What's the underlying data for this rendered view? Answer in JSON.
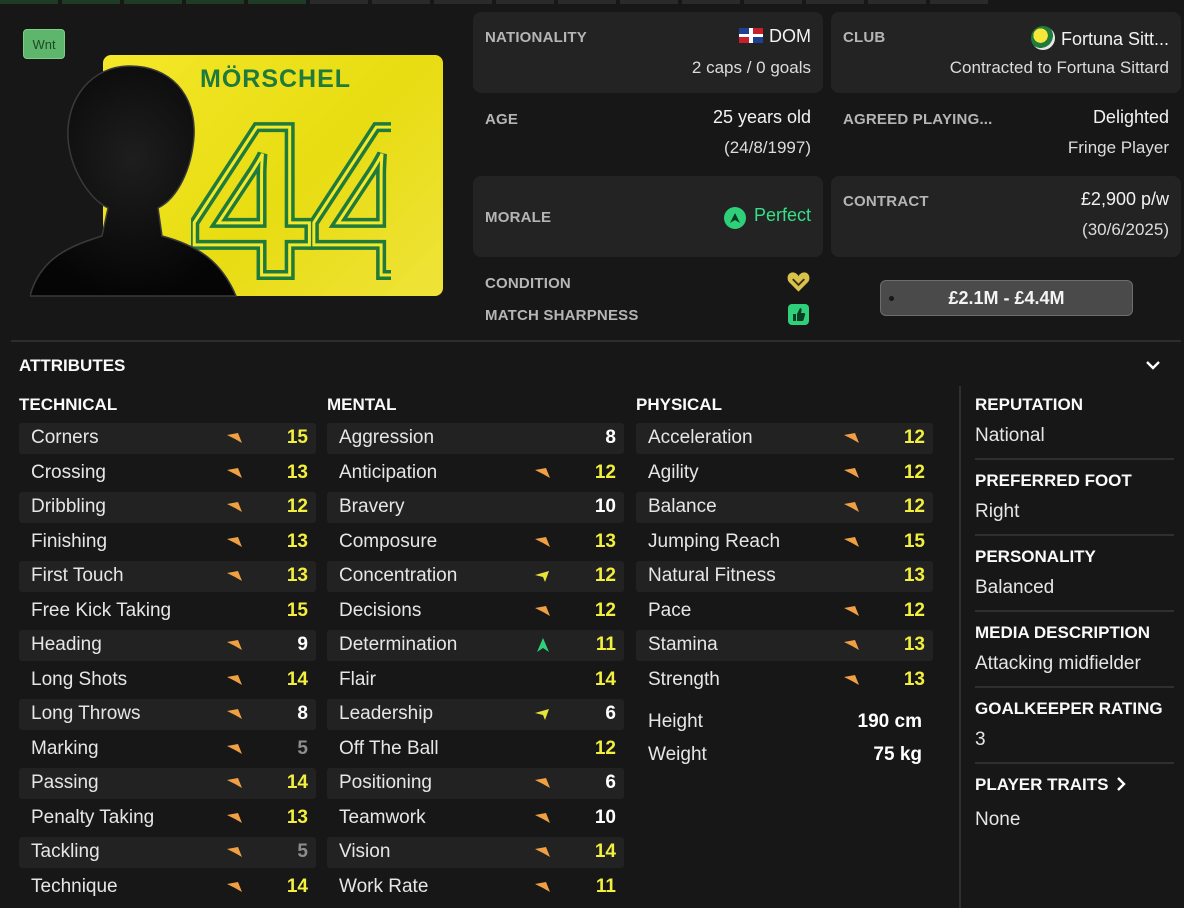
{
  "badge": "Wnt",
  "shirt": {
    "name": "MÖRSCHEL",
    "number": "44"
  },
  "header": {
    "nationality": {
      "label": "NATIONALITY",
      "value": "DOM",
      "sub": "2 caps / 0 goals",
      "flag_icon": "dominican-republic-flag"
    },
    "club": {
      "label": "CLUB",
      "value": "Fortuna Sitt...",
      "sub": "Contracted to Fortuna Sittard",
      "crest_icon": "fortuna-sittard-crest"
    },
    "age": {
      "label": "AGE",
      "value": "25 years old",
      "sub": "(24/8/1997)"
    },
    "playing_time": {
      "label": "AGREED PLAYING...",
      "value": "Delighted",
      "sub": "Fringe Player"
    },
    "morale": {
      "label": "MORALE",
      "value": "Perfect",
      "icon": "morale-up-icon",
      "color": "#35e088"
    },
    "contract": {
      "label": "CONTRACT",
      "value": "£2,900 p/w",
      "sub": "(30/6/2025)"
    },
    "condition": {
      "label": "CONDITION",
      "icon": "heart-icon"
    },
    "sharpness": {
      "label": "MATCH SHARPNESS",
      "icon": "thumbs-up-icon"
    },
    "value_range": "£2.1M - £4.4M"
  },
  "section_title": "ATTRIBUTES",
  "technical": {
    "title": "TECHNICAL",
    "rows": [
      {
        "name": "Corners",
        "value": "15",
        "trend": "up-orange"
      },
      {
        "name": "Crossing",
        "value": "13",
        "trend": "up-orange"
      },
      {
        "name": "Dribbling",
        "value": "12",
        "trend": "up-orange"
      },
      {
        "name": "Finishing",
        "value": "13",
        "trend": "up-orange"
      },
      {
        "name": "First Touch",
        "value": "13",
        "trend": "up-orange"
      },
      {
        "name": "Free Kick Taking",
        "value": "15",
        "trend": ""
      },
      {
        "name": "Heading",
        "value": "9",
        "trend": "up-orange"
      },
      {
        "name": "Long Shots",
        "value": "14",
        "trend": "up-orange"
      },
      {
        "name": "Long Throws",
        "value": "8",
        "trend": "up-orange"
      },
      {
        "name": "Marking",
        "value": "5",
        "trend": "up-orange"
      },
      {
        "name": "Passing",
        "value": "14",
        "trend": "up-orange"
      },
      {
        "name": "Penalty Taking",
        "value": "13",
        "trend": "up-orange"
      },
      {
        "name": "Tackling",
        "value": "5",
        "trend": "up-orange"
      },
      {
        "name": "Technique",
        "value": "14",
        "trend": "up-orange"
      }
    ]
  },
  "mental": {
    "title": "MENTAL",
    "rows": [
      {
        "name": "Aggression",
        "value": "8",
        "trend": ""
      },
      {
        "name": "Anticipation",
        "value": "12",
        "trend": "up-orange"
      },
      {
        "name": "Bravery",
        "value": "10",
        "trend": ""
      },
      {
        "name": "Composure",
        "value": "13",
        "trend": "up-orange"
      },
      {
        "name": "Concentration",
        "value": "12",
        "trend": "up-yellow"
      },
      {
        "name": "Decisions",
        "value": "12",
        "trend": "up-orange"
      },
      {
        "name": "Determination",
        "value": "11",
        "trend": "up-green"
      },
      {
        "name": "Flair",
        "value": "14",
        "trend": ""
      },
      {
        "name": "Leadership",
        "value": "6",
        "trend": "up-yellow"
      },
      {
        "name": "Off The Ball",
        "value": "12",
        "trend": ""
      },
      {
        "name": "Positioning",
        "value": "6",
        "trend": "up-orange"
      },
      {
        "name": "Teamwork",
        "value": "10",
        "trend": "up-orange"
      },
      {
        "name": "Vision",
        "value": "14",
        "trend": "up-orange"
      },
      {
        "name": "Work Rate",
        "value": "11",
        "trend": "up-orange"
      }
    ]
  },
  "physical": {
    "title": "PHYSICAL",
    "rows": [
      {
        "name": "Acceleration",
        "value": "12",
        "trend": "up-orange"
      },
      {
        "name": "Agility",
        "value": "12",
        "trend": "up-orange"
      },
      {
        "name": "Balance",
        "value": "12",
        "trend": "up-orange"
      },
      {
        "name": "Jumping Reach",
        "value": "15",
        "trend": "up-orange"
      },
      {
        "name": "Natural Fitness",
        "value": "13",
        "trend": ""
      },
      {
        "name": "Pace",
        "value": "12",
        "trend": "up-orange"
      },
      {
        "name": "Stamina",
        "value": "13",
        "trend": "up-orange"
      },
      {
        "name": "Strength",
        "value": "13",
        "trend": "up-orange"
      }
    ],
    "height": {
      "label": "Height",
      "value": "190 cm"
    },
    "weight": {
      "label": "Weight",
      "value": "75 kg"
    }
  },
  "info": {
    "reputation": {
      "label": "REPUTATION",
      "value": "National"
    },
    "preferred_foot": {
      "label": "PREFERRED FOOT",
      "value": "Right"
    },
    "personality": {
      "label": "PERSONALITY",
      "value": "Balanced"
    },
    "media": {
      "label": "MEDIA DESCRIPTION",
      "value": "Attacking midfielder"
    },
    "gk_rating": {
      "label": "GOALKEEPER RATING",
      "value": "3"
    },
    "traits": {
      "label": "PLAYER TRAITS",
      "value": "None"
    }
  },
  "colors": {
    "high": "#f2ef3f",
    "mid": "#ffffff",
    "low": "#8d8d8d",
    "arrow_orange": "#f0a043",
    "arrow_yellow": "#e8e33a",
    "arrow_green": "#2fd07a"
  }
}
